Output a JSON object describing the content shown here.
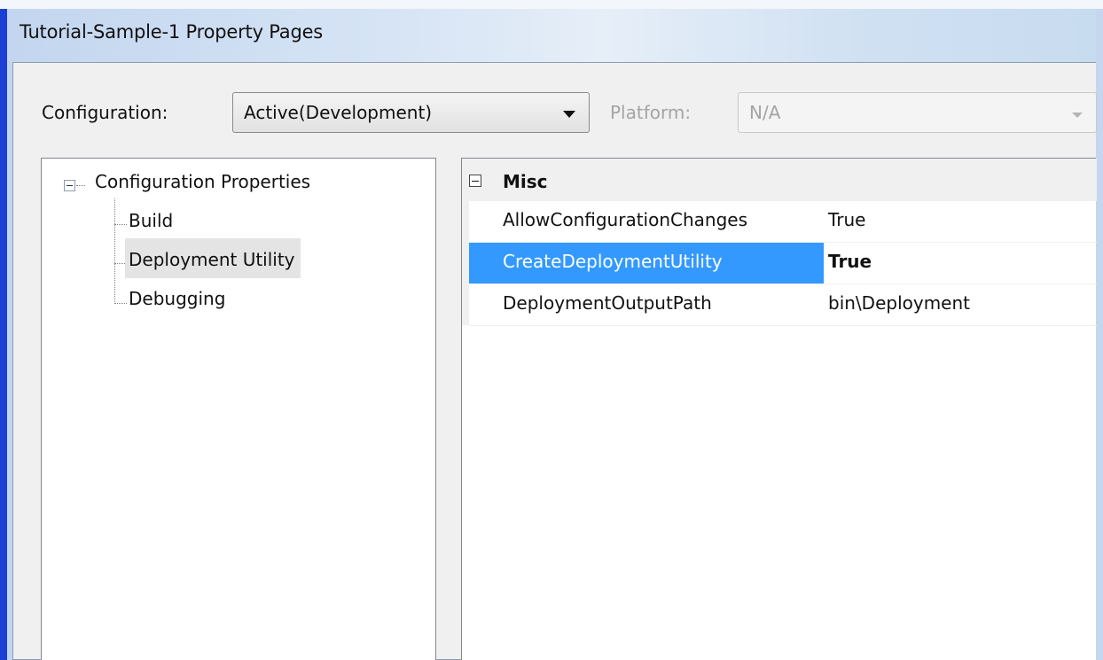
{
  "window": {
    "title": "Tutorial-Sample-1 Property Pages"
  },
  "toolbar": {
    "configuration_label": "Configuration:",
    "configuration_value": "Active(Development)",
    "platform_label": "Platform:",
    "platform_value": "N/A"
  },
  "tree": {
    "root": "Configuration Properties",
    "children": [
      "Build",
      "Deployment Utility",
      "Debugging"
    ],
    "selected": "Deployment Utility"
  },
  "grid": {
    "category": "Misc",
    "properties": [
      {
        "name": "AllowConfigurationChanges",
        "value": "True"
      },
      {
        "name": "CreateDeploymentUtility",
        "value": "True"
      },
      {
        "name": "DeploymentOutputPath",
        "value": "bin\\Deployment"
      }
    ],
    "selected": "CreateDeploymentUtility"
  },
  "colors": {
    "selection": "#3399ff",
    "frame": "#1c3fd6",
    "disabled_text": "#a4a4a4"
  }
}
